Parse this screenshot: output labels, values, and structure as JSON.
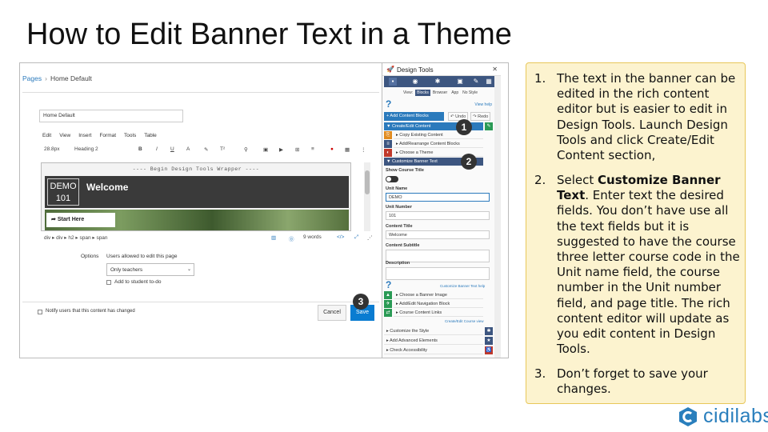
{
  "slide": {
    "title": "How to Edit Banner Text in a Theme"
  },
  "editor": {
    "breadcrumb": {
      "link": "Pages",
      "current": "Home Default"
    },
    "title_value": "Home Default",
    "menu": [
      "Edit",
      "View",
      "Insert",
      "Format",
      "Tools",
      "Table"
    ],
    "format_bar": {
      "font_size": "28.8px",
      "block": "Heading 2",
      "bold": "B",
      "italic": "I",
      "underline": "U",
      "text_color": "A",
      "superscript": "T²"
    },
    "wrapper_label": "---- Begin Design Tools Wrapper ----",
    "banner": {
      "unit_name": "DEMO",
      "unit_number": "101",
      "title": "Welcome"
    },
    "start_button": "Start Here",
    "path": "div ▸ div ▸ h2 ▸ span ▸ span",
    "word_count": "9 words",
    "code_icon": "</>",
    "options_label": "Options",
    "allowed_label": "Users allowed to edit this page",
    "allowed_value": "Only teachers",
    "add_to_student": "Add to student to-do",
    "notify": "Notify users that this content has changed",
    "cancel": "Cancel",
    "save": "Save"
  },
  "markers": [
    "1",
    "2",
    "3"
  ],
  "design_tools": {
    "title": "Design Tools",
    "close": "✕",
    "view_label": "View:",
    "views": [
      "Blocks",
      "Browser",
      "App",
      "No Style"
    ],
    "active_view": "Blocks",
    "view_help": "View help",
    "add_content": "+ Add Content Blocks",
    "undo": "↶ Undo",
    "redo": "↷ Redo",
    "section_create": "▼ Create/Edit Content",
    "items_top": [
      "▸ Copy Existing Content",
      "▸ Add/Rearrange Content Blocks",
      "▸ Choose a Theme"
    ],
    "section_banner": "▼ Customize Banner Text",
    "show_course_title": "Show Course Title",
    "unit_name_label": "Unit Name",
    "unit_name_value": "DEMO",
    "unit_number_label": "Unit Number",
    "unit_number_value": "101",
    "content_title_label": "Content Title",
    "content_title_value": "Welcome",
    "content_subtitle_label": "Content Subtitle",
    "description_label": "Description",
    "customize_link": "Customize Banner Text help",
    "items_bottom": [
      "▸ Choose a Banner Image",
      "▸ Add/Edit Navigation Block",
      "▸ Course Content Links"
    ],
    "create_nav_link": "Create/Edit Course view",
    "items_more": [
      "▸ Customize the Style",
      "▸ Add Advanced Elements",
      "▸ Check Accessibility"
    ]
  },
  "instructions": {
    "step1_num": "1.",
    "step1": "The text in the banner can be edited in the rich content editor but is easier to edit in Design Tools. Launch Design Tools and click Create/Edit Content section,",
    "step2_num": "2.",
    "step2_pre": "Select ",
    "step2_bold": "Customize Banner Text",
    "step2_post": ". Enter text the desired fields. You don’t have use all the text fields but it is suggested to have the course three letter course code in the Unit name field, the course number in the Unit number field, and page title. The rich content editor will update as you edit content in Design Tools.",
    "step3_num": "3.",
    "step3": "Don’t forget to save your changes."
  },
  "brand": {
    "name": "cidilabs"
  },
  "colors": {
    "accent": "#2b7abc",
    "highlight_bg": "#fcf3cf",
    "highlight_border": "#e8c75a",
    "save": "#0a7cd1"
  }
}
